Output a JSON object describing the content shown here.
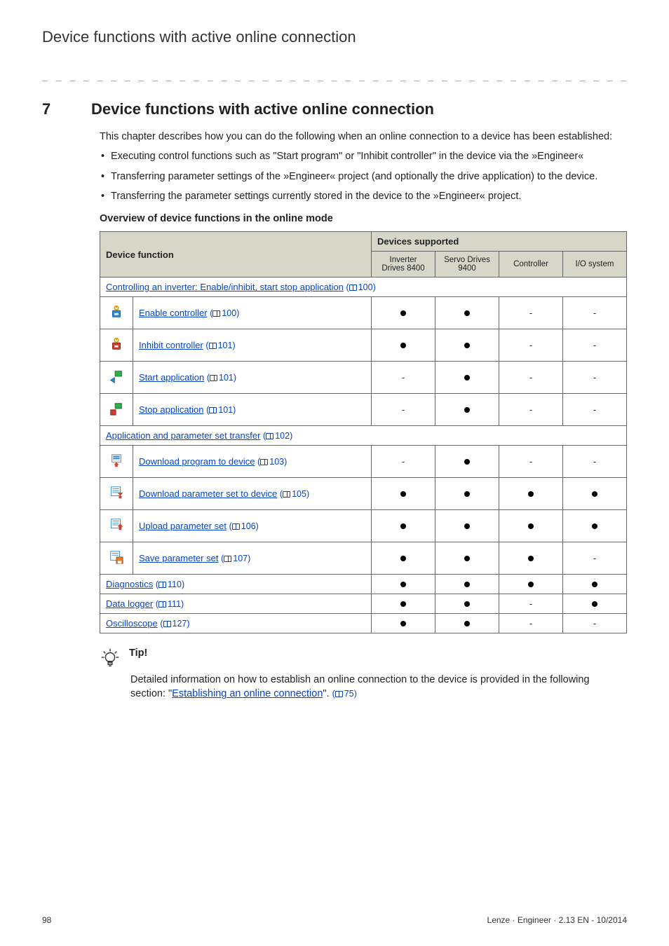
{
  "running_header": "Device functions with active online connection",
  "section": {
    "number": "7",
    "title": "Device functions with active online connection"
  },
  "intro": "This chapter describes how you can do the following when an online connection to a device has been established:",
  "bullets": [
    "Executing control functions such as \"Start program\" or \"Inhibit controller\" in the device via the »Engineer«",
    "Transferring parameter settings of the »Engineer« project (and optionally the drive application) to the device.",
    "Transferring the parameter settings currently stored in the device to the »Engineer« project."
  ],
  "overview_heading": "Overview of device functions in the online mode",
  "table": {
    "header_main_left": "Device function",
    "header_main_right": "Devices supported",
    "sub_headers": [
      "Inverter Drives 8400",
      "Servo Drives 9400",
      "Controller",
      "I/O system"
    ],
    "groups": [
      {
        "title": "Controlling an inverter: Enable/inhibit, start stop application",
        "page": "100",
        "rows": [
          {
            "icon": "enable-controller-icon",
            "label": "Enable controller",
            "page": "100",
            "support": [
              "dot",
              "dot",
              "-",
              "-"
            ]
          },
          {
            "icon": "inhibit-controller-icon",
            "label": "Inhibit controller",
            "page": "101",
            "support": [
              "dot",
              "dot",
              "-",
              "-"
            ]
          },
          {
            "icon": "start-application-icon",
            "label": "Start application",
            "page": "101",
            "support": [
              "-",
              "dot",
              "-",
              "-"
            ]
          },
          {
            "icon": "stop-application-icon",
            "label": "Stop application",
            "page": "101",
            "support": [
              "-",
              "dot",
              "-",
              "-"
            ]
          }
        ]
      },
      {
        "title": "Application and parameter set transfer",
        "page": "102",
        "rows": [
          {
            "icon": "download-program-icon",
            "label": "Download program to device",
            "page": "103",
            "support": [
              "-",
              "dot",
              "-",
              "-"
            ]
          },
          {
            "icon": "download-paramset-icon",
            "label": "Download parameter set to device",
            "page": "105",
            "support": [
              "dot",
              "dot",
              "dot",
              "dot"
            ]
          },
          {
            "icon": "upload-paramset-icon",
            "label": "Upload parameter set",
            "page": "106",
            "support": [
              "dot",
              "dot",
              "dot",
              "dot"
            ]
          },
          {
            "icon": "save-paramset-icon",
            "label": "Save parameter set",
            "page": "107",
            "support": [
              "dot",
              "dot",
              "dot",
              "-"
            ]
          }
        ]
      }
    ],
    "simple_rows": [
      {
        "label": "Diagnostics",
        "page": "110",
        "support": [
          "dot",
          "dot",
          "dot",
          "dot"
        ]
      },
      {
        "label": "Data logger",
        "page": "111",
        "support": [
          "dot",
          "dot",
          "-",
          "dot"
        ]
      },
      {
        "label": "Oscilloscope",
        "page": "127",
        "support": [
          "dot",
          "dot",
          "-",
          "-"
        ]
      }
    ]
  },
  "tip": {
    "label": "Tip!",
    "body_prefix": "Detailed information on how to establish an online connection to the device is provided in the following section: \"",
    "link_text": "Establishing an online connection",
    "body_suffix": "\".",
    "page": "75"
  },
  "footer": {
    "page_number": "98",
    "doc_id": "Lenze · Engineer · 2.13 EN - 10/2014"
  }
}
